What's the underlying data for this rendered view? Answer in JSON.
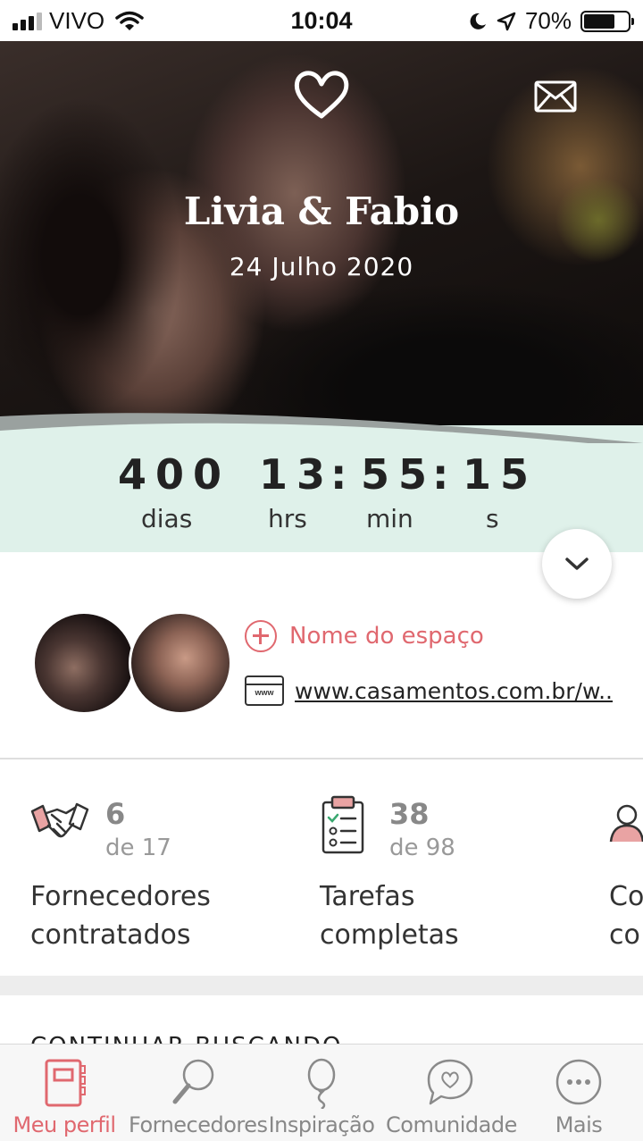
{
  "status_bar": {
    "carrier": "VIVO",
    "time": "10:04",
    "battery": "70%",
    "battery_level": 0.7
  },
  "hero": {
    "names": "Livia & Fabio",
    "date": "24 Julho 2020"
  },
  "countdown": {
    "days": "400",
    "hours": "13",
    "minutes": "55",
    "seconds": "15",
    "separator": ":",
    "days_label": "dias",
    "hours_label": "hrs",
    "minutes_label": "min",
    "seconds_label": "s"
  },
  "profile": {
    "add_space_label": "Nome do espaço",
    "website": "www.casamentos.com.br/w...",
    "www_icon_text": "www"
  },
  "stats": [
    {
      "count": "6",
      "total": "de 17",
      "label": "Fornecedores contratados",
      "icon": "handshake-icon"
    },
    {
      "count": "38",
      "total": "de 98",
      "label": "Tarefas completas",
      "icon": "checklist-icon"
    },
    {
      "count": "",
      "total": "",
      "label": "Co co",
      "icon": "guests-icon"
    }
  ],
  "section": {
    "title": "CONTINUAR BUSCANDO"
  },
  "tabs": [
    {
      "label": "Meu perfil",
      "icon": "notebook-icon",
      "active": true
    },
    {
      "label": "Fornecedores",
      "icon": "magnifier-icon",
      "active": false
    },
    {
      "label": "Inspiração",
      "icon": "balloon-icon",
      "active": false
    },
    {
      "label": "Comunidade",
      "icon": "chat-heart-icon",
      "active": false
    },
    {
      "label": "Mais",
      "icon": "more-icon",
      "active": false
    }
  ],
  "colors": {
    "accent": "#e0686f",
    "mint": "#dff1ea",
    "gray_wave": "#9aa19f"
  }
}
